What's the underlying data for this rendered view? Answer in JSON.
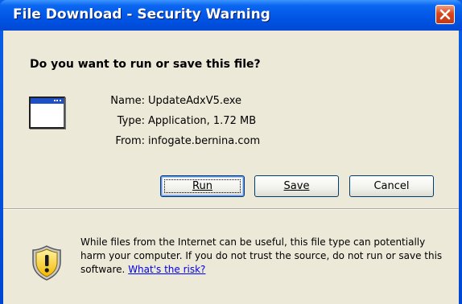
{
  "window": {
    "title": "File Download - Security Warning"
  },
  "dialog": {
    "question": "Do you want to run or save this file?",
    "file_icon": "application-window-icon",
    "details": [
      {
        "label": "Name:",
        "value": "UpdateAdxV5.exe"
      },
      {
        "label": "Type:",
        "value": "Application, 1.72 MB"
      },
      {
        "label": "From:",
        "value": "infogate.bernina.com"
      }
    ]
  },
  "buttons": {
    "run": "Run",
    "save": "Save",
    "cancel": "Cancel"
  },
  "warning": {
    "icon": "shield-warning-icon",
    "text": "While files from the Internet can be useful, this file type can potentially harm your computer. If you do not trust the source, do not run or save this software.",
    "link": "What's the risk?"
  },
  "colors": {
    "titlebar": "#0055e5",
    "dialog_bg": "#ece9d8",
    "close_button": "#d8461c",
    "link": "#0000ee"
  }
}
